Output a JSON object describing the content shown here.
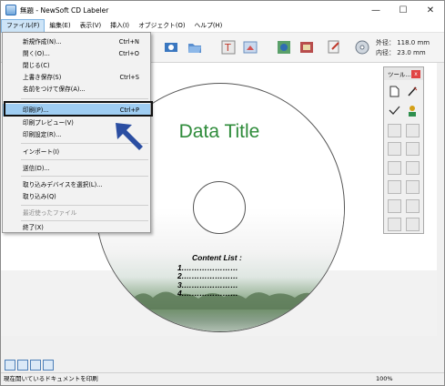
{
  "window": {
    "title": "無題 - NewSoft CD Labeler",
    "minimize": "—",
    "maximize": "☐",
    "close": "✕"
  },
  "menu": [
    {
      "label": "ファイル(F)",
      "active": true
    },
    {
      "label": "編集(E)"
    },
    {
      "label": "表示(V)"
    },
    {
      "label": "挿入(I)"
    },
    {
      "label": "オブジェクト(O)"
    },
    {
      "label": "ヘルプ(H)"
    }
  ],
  "size": {
    "outer": "外径：  118.0 mm",
    "inner": "内径：  23.0 mm"
  },
  "file_menu": {
    "items": [
      {
        "label": "新規作成(N)...",
        "shortcut": "Ctrl+N"
      },
      {
        "label": "開く(O)...",
        "shortcut": "Ctrl+O"
      },
      {
        "label": "閉じる(C)",
        "shortcut": ""
      },
      {
        "label": "上書き保存(S)",
        "shortcut": "Ctrl+S"
      },
      {
        "label": "名前をつけて保存(A)...",
        "shortcut": ""
      },
      {
        "label": "印刷(P)...",
        "shortcut": "Ctrl+P",
        "highlighted": true
      },
      {
        "label": "印刷プレビュー(V)",
        "shortcut": ""
      },
      {
        "label": "印刷設定(R)...",
        "shortcut": ""
      },
      {
        "label": "インポート(I)",
        "shortcut": ""
      },
      {
        "label": "送信(D)...",
        "shortcut": ""
      },
      {
        "label": "取り込みデバイスを選択(L)...",
        "shortcut": ""
      },
      {
        "label": "取り込み(Q)",
        "shortcut": ""
      },
      {
        "label": "最近使ったファイル",
        "shortcut": "",
        "disabled": true
      },
      {
        "label": "終了(X)",
        "shortcut": ""
      }
    ]
  },
  "disc": {
    "title": "Data Title",
    "content_heading": "Content List :",
    "lines": [
      "1.…………………",
      "2.…………………",
      "3.…………………",
      "4.…………………"
    ]
  },
  "palette": {
    "title": "ツール...",
    "close": "x"
  },
  "status": {
    "text": "現在開いているドキュメントを印刷",
    "zoom": "100%"
  },
  "colors": {
    "highlight": "#9fcdf2",
    "title_green": "#2e8b3a",
    "arrow_blue": "#2b4ea2"
  }
}
